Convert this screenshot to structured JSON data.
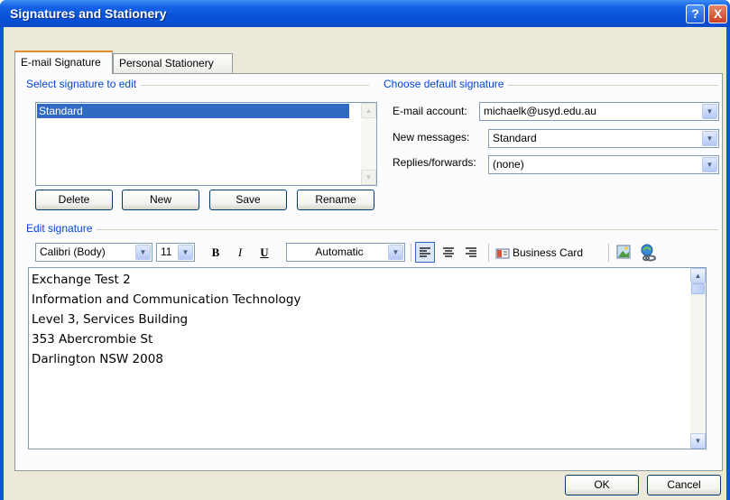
{
  "window": {
    "title": "Signatures and Stationery",
    "help_label": "?",
    "close_label": "X"
  },
  "tabs": [
    {
      "label": "E-mail Signature",
      "active": true
    },
    {
      "label": "Personal Stationery",
      "active": false
    }
  ],
  "select_signature": {
    "group_label": "Select signature to edit",
    "items": [
      "Standard"
    ],
    "selected": "Standard",
    "buttons": {
      "delete": "Delete",
      "new": "New",
      "save": "Save",
      "rename": "Rename"
    }
  },
  "default_signature": {
    "group_label": "Choose default signature",
    "email_account_label": "E-mail account:",
    "email_account_value": "michaelk@usyd.edu.au",
    "new_messages_label": "New messages:",
    "new_messages_value": "Standard",
    "replies_label": "Replies/forwards:",
    "replies_value": "(none)"
  },
  "edit_signature": {
    "group_label": "Edit signature",
    "toolbar": {
      "font": "Calibri (Body)",
      "size": "11",
      "bold_label": "B",
      "italic_label": "I",
      "underline_label": "U",
      "color": "Automatic",
      "business_card_label": "Business Card"
    },
    "lines": [
      "Exchange Test 2",
      "Information and Communication Technology",
      "Level 3, Services Building",
      "353 Abercrombie St",
      "Darlington NSW 2008"
    ]
  },
  "footer": {
    "ok_label": "OK",
    "cancel_label": "Cancel"
  },
  "colors": {
    "titlebar": "#0a4ccb",
    "dialog_bg": "#ece9d8",
    "selection": "#316ac5",
    "group_label": "#0046d5",
    "active_tab_accent": "#e68b2c"
  },
  "icons": {
    "help": "help-icon",
    "close": "close-icon",
    "dropdown": "chevron-down-icon",
    "align_left": "align-left-icon",
    "align_center": "align-center-icon",
    "align_right": "align-right-icon",
    "business_card": "business-card-icon",
    "insert_picture": "insert-picture-icon",
    "insert_hyperlink": "insert-hyperlink-icon"
  }
}
